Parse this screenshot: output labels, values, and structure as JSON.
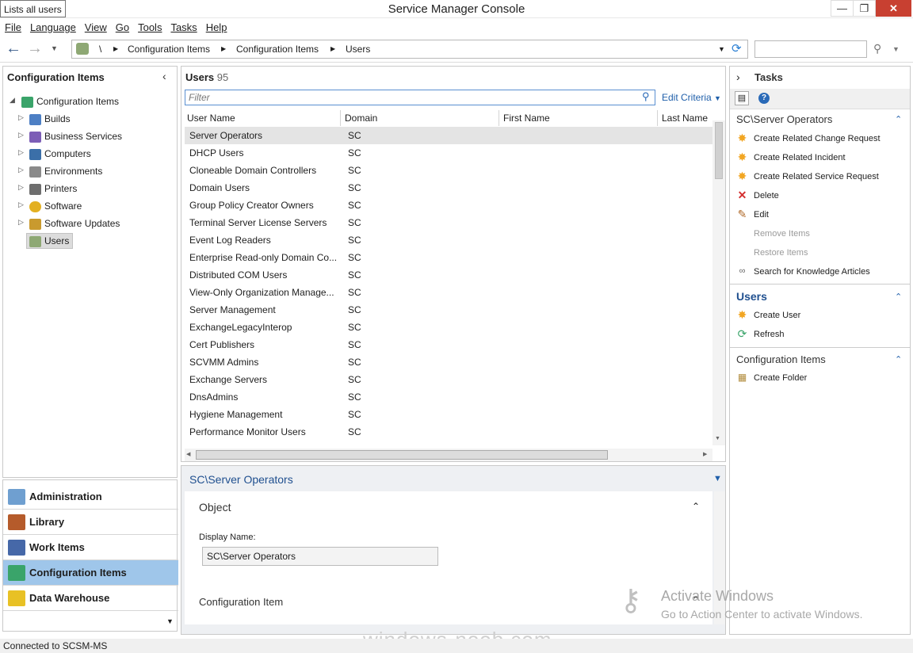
{
  "window": {
    "title": "Service Manager Console",
    "tooltip": "Lists all users",
    "min": "—",
    "max": "❐",
    "close": "✕"
  },
  "menu": [
    "File",
    "Language",
    "View",
    "Go",
    "Tools",
    "Tasks",
    "Help"
  ],
  "address": {
    "root": "\\",
    "crumbs": [
      "Configuration Items",
      "Configuration Items",
      "Users"
    ],
    "search_value": ""
  },
  "left": {
    "title": "Configuration Items",
    "root": "Configuration Items",
    "items": [
      "Builds",
      "Business Services",
      "Computers",
      "Environments",
      "Printers",
      "Software",
      "Software Updates",
      "Users"
    ]
  },
  "nav": [
    "Administration",
    "Library",
    "Work Items",
    "Configuration Items",
    "Data Warehouse"
  ],
  "list": {
    "title": "Users",
    "count": "95",
    "filter_placeholder": "Filter",
    "edit_criteria": "Edit Criteria",
    "columns": [
      "User Name",
      "Domain",
      "First Name",
      "Last Name"
    ],
    "rows": [
      [
        "Server Operators",
        "SC"
      ],
      [
        "DHCP Users",
        "SC"
      ],
      [
        "Cloneable Domain Controllers",
        "SC"
      ],
      [
        "Domain Users",
        "SC"
      ],
      [
        "Group Policy Creator Owners",
        "SC"
      ],
      [
        "Terminal Server License Servers",
        "SC"
      ],
      [
        "Event Log Readers",
        "SC"
      ],
      [
        "Enterprise Read-only Domain Co...",
        "SC"
      ],
      [
        "Distributed COM Users",
        "SC"
      ],
      [
        "View-Only Organization Manage...",
        "SC"
      ],
      [
        "Server Management",
        "SC"
      ],
      [
        "ExchangeLegacyInterop",
        "SC"
      ],
      [
        "Cert Publishers",
        "SC"
      ],
      [
        "SCVMM Admins",
        "SC"
      ],
      [
        "Exchange Servers",
        "SC"
      ],
      [
        "DnsAdmins",
        "SC"
      ],
      [
        "Hygiene Management",
        "SC"
      ],
      [
        "Performance Monitor Users",
        "SC"
      ]
    ]
  },
  "detail": {
    "title": "SC\\Server Operators",
    "section1": "Object",
    "display_name_label": "Display Name:",
    "display_name_value": "SC\\Server Operators",
    "section2": "Configuration Item"
  },
  "tasks": {
    "title": "Tasks",
    "group1": {
      "title": "SC\\Server Operators",
      "items": [
        "Create Related Change Request",
        "Create Related Incident",
        "Create Related Service Request",
        "Delete",
        "Edit",
        "Remove Items",
        "Restore Items",
        "Search for Knowledge Articles"
      ]
    },
    "group2": {
      "title": "Users",
      "items": [
        "Create User",
        "Refresh"
      ]
    },
    "group3": {
      "title": "Configuration Items",
      "items": [
        "Create Folder"
      ]
    }
  },
  "status": "Connected to SCSM-MS",
  "watermark": {
    "line1": "Activate Windows",
    "line2": "Go to Action Center to activate Windows.",
    "site": "windows-noob.com"
  }
}
